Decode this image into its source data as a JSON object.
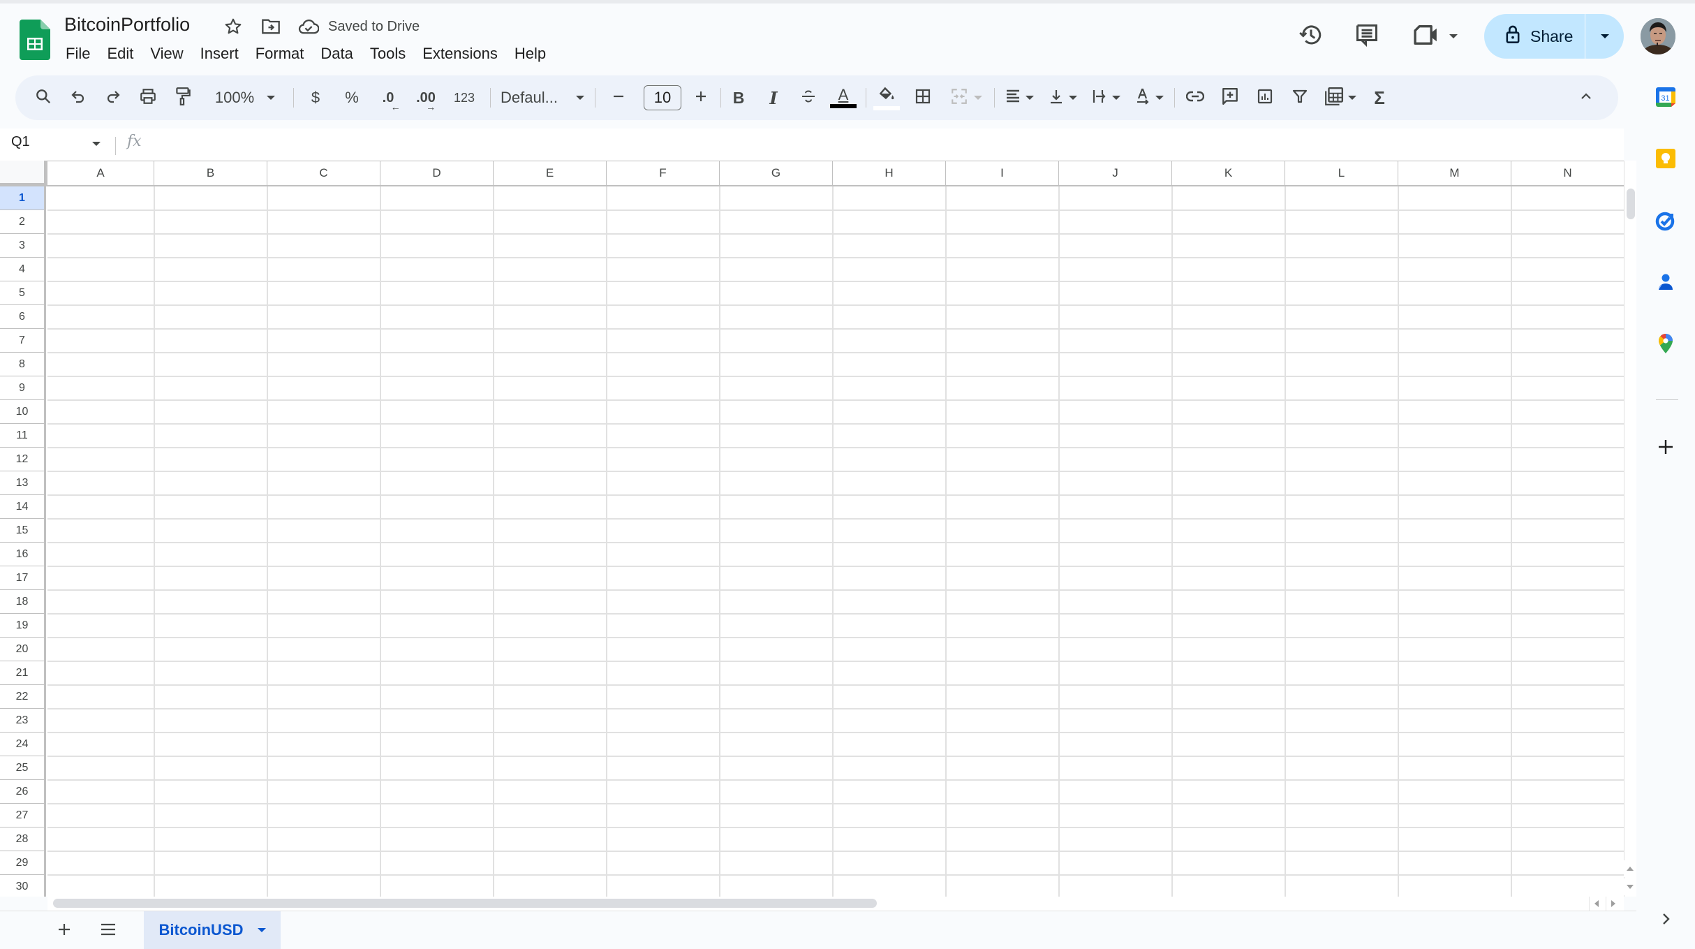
{
  "app": {
    "document_title": "BitcoinPortfolio",
    "save_status": "Saved to Drive",
    "menu": [
      "File",
      "Edit",
      "View",
      "Insert",
      "Format",
      "Data",
      "Tools",
      "Extensions",
      "Help"
    ],
    "share_label": "Share",
    "header_icons": [
      "version-history-icon",
      "comments-icon",
      "meet-icon"
    ]
  },
  "toolbar": {
    "zoom": "100%",
    "currency": "$",
    "percent": "%",
    "decrease_decimal": ".0",
    "increase_decimal": ".00",
    "more_formats": "123",
    "font": "Defaul...",
    "font_size": "10",
    "text_color": "#000000",
    "fill_color": "#ffffff"
  },
  "formula_bar": {
    "name_box": "Q1",
    "fx_label": "fx",
    "formula": ""
  },
  "grid": {
    "columns": [
      "A",
      "B",
      "C",
      "D",
      "E",
      "F",
      "G",
      "H",
      "I",
      "J",
      "K",
      "L",
      "M",
      "N"
    ],
    "rows": [
      "1",
      "2",
      "3",
      "4",
      "5",
      "6",
      "7",
      "8",
      "9",
      "10",
      "11",
      "12",
      "13",
      "14",
      "15",
      "16",
      "17",
      "18",
      "19",
      "20",
      "21",
      "22",
      "23",
      "24",
      "25",
      "26",
      "27",
      "28",
      "29",
      "30"
    ],
    "selected_row": "1"
  },
  "sheets": {
    "tabs": [
      {
        "label": "BitcoinUSD",
        "active": true
      }
    ]
  },
  "side_panel": {
    "apps": [
      "calendar-icon",
      "keep-icon",
      "tasks-icon",
      "contacts-icon",
      "maps-icon"
    ],
    "calendar_day": "31"
  },
  "colors": {
    "brand_green": "#0f9d58",
    "share_bg": "#c2e7ff",
    "accent_blue": "#0b57d0",
    "toolbar_bg": "#edf2fa",
    "selected_header_bg": "#d3e3fd"
  }
}
